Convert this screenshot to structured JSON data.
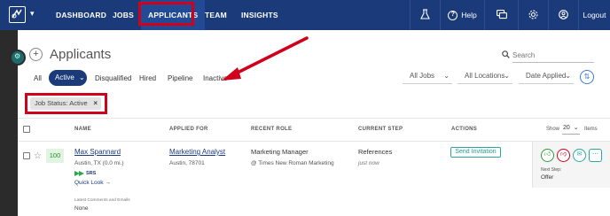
{
  "colors": {
    "nav_bg": "#1a3a7a",
    "highlight_red": "#d0021b",
    "accent_teal": "#2aa8a0",
    "score_green": "#2e8b2e"
  },
  "nav": {
    "items": [
      {
        "label": "DASHBOARD"
      },
      {
        "label": "JOBS"
      },
      {
        "label": "APPLICANTS"
      },
      {
        "label": "TEAM"
      },
      {
        "label": "INSIGHTS"
      }
    ],
    "help_label": "Help",
    "logout_label": "Logout",
    "icons": [
      "flask-icon",
      "help-icon",
      "chat-icon",
      "gear-icon",
      "user-circle-icon"
    ]
  },
  "page": {
    "title": "Applicants",
    "search_placeholder": "Search"
  },
  "filters": {
    "tabs": [
      "All",
      "Active",
      "Disqualified",
      "Hired",
      "Pipeline",
      "Inactive"
    ],
    "active_tab": "Active",
    "dropdowns": [
      "All Jobs",
      "All Locations",
      "Date Applied"
    ]
  },
  "chip": {
    "label": "Job Status: Active",
    "close": "×"
  },
  "table": {
    "headers": {
      "name": "NAME",
      "applied_for": "APPLIED FOR",
      "recent_role": "RECENT ROLE",
      "current_step": "CURRENT STEP",
      "actions": "ACTIONS"
    },
    "show_label": "Show",
    "show_value": "20",
    "items_label": "Items"
  },
  "applicant": {
    "score": "100",
    "name": "Max Spannard",
    "location": "Austin, TX (0.0 mi.)",
    "tag": "SRS",
    "quick_look": "Quick Look →",
    "job_title": "Marketing Analyst",
    "job_location": "Austin, 78701",
    "role_title": "Marketing Manager",
    "role_company": "@ Times New Roman Marketing",
    "step": "References",
    "step_time": "just now",
    "action_label": "Send Invitation",
    "next_step_label": "Next Step:",
    "next_step_value": "Offer",
    "latest_label": "Latest Comments and Emails",
    "latest_value": "None"
  }
}
